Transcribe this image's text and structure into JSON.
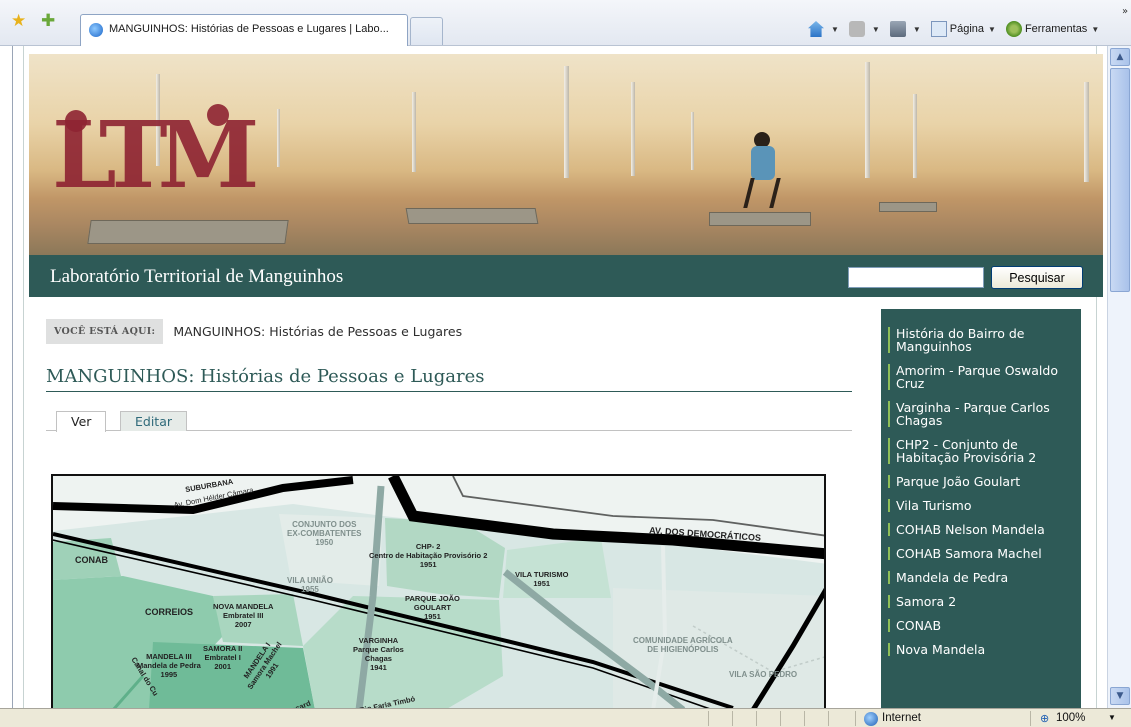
{
  "browser": {
    "tab_title": "MANGUINHOS: Histórias de Pessoas e Lugares | Labo...",
    "commands": {
      "page": "Página",
      "tools": "Ferramentas"
    },
    "status": {
      "zone": "Internet",
      "zoom": "100%"
    },
    "icons": [
      "favorites-star-icon",
      "add-favorites-icon",
      "home-icon",
      "feeds-icon",
      "print-icon",
      "page-icon",
      "tools-gear-icon",
      "internet-zone-icon",
      "zoom-icon"
    ]
  },
  "site": {
    "logo": "LTM",
    "title": "Laboratório Territorial de Manguinhos",
    "search": {
      "placeholder": "",
      "button": "Pesquisar"
    },
    "colors": {
      "brand": "#2e5a57",
      "accent": "#8fbf58",
      "logo": "#8e2332"
    }
  },
  "breadcrumb": {
    "label": "VOCÊ ESTÁ AQUI:",
    "current": "MANGUINHOS: Histórias de Pessoas e Lugares"
  },
  "main": {
    "title": "MANGUINHOS: Histórias de Pessoas e Lugares",
    "tabs": [
      {
        "label": "Ver",
        "active": true
      },
      {
        "label": "Editar",
        "active": false
      }
    ],
    "map": {
      "labels": {
        "suburbana": "SUBURBANA",
        "av_helder": "Av. Dom Hélder Câmara",
        "conjunto": "CONJUNTO DOS\nEX-COMBATENTES\n1950",
        "chp2": "CHP- 2\nCentro de Habitação Provisório 2\n1951",
        "democraticos": "AV. DOS DEMOCRÁTICOS",
        "conab": "CONAB",
        "vila_turismo": "VILA TURISMO\n1951",
        "vila_uniao": "VILA UNIÃO\n1955",
        "parque_joao": "PARQUE JOÃO\nGOULART\n1951",
        "correios": "CORREIOS",
        "nova_mandela": "NOVA MANDELA\nEmbratel III\n2007",
        "varginha": "VARGINHA\nParque Carlos\nChagas\n1941",
        "agricola": "COMUNIDADE AGRÍCOLA\nDE HIGIENÓPOLIS",
        "vila_sao_pedro": "VILA SÃO PEDRO",
        "mandela3": "MANDELA III\nMandela de Pedra\n1995",
        "samora2": "SAMORA II\nEmbratel I\n2001",
        "mandela1": "MANDELA I\nSamora Machel\n1991",
        "canal": "Canal do Cu",
        "rio_faria": "Rio Faria Timbó",
        "sard": "ssard"
      }
    }
  },
  "sidebar": {
    "items": [
      {
        "label": "História do Bairro de Manguinhos"
      },
      {
        "label": "Amorim - Parque Oswaldo Cruz"
      },
      {
        "label": "Varginha - Parque Carlos Chagas"
      },
      {
        "label": "CHP2 - Conjunto de Habitação Provisória 2"
      },
      {
        "label": "Parque João Goulart"
      },
      {
        "label": "Vila Turismo"
      },
      {
        "label": "COHAB Nelson Mandela"
      },
      {
        "label": "COHAB Samora Machel"
      },
      {
        "label": "Mandela de Pedra"
      },
      {
        "label": "Samora 2"
      },
      {
        "label": "CONAB"
      },
      {
        "label": "Nova Mandela"
      }
    ]
  }
}
